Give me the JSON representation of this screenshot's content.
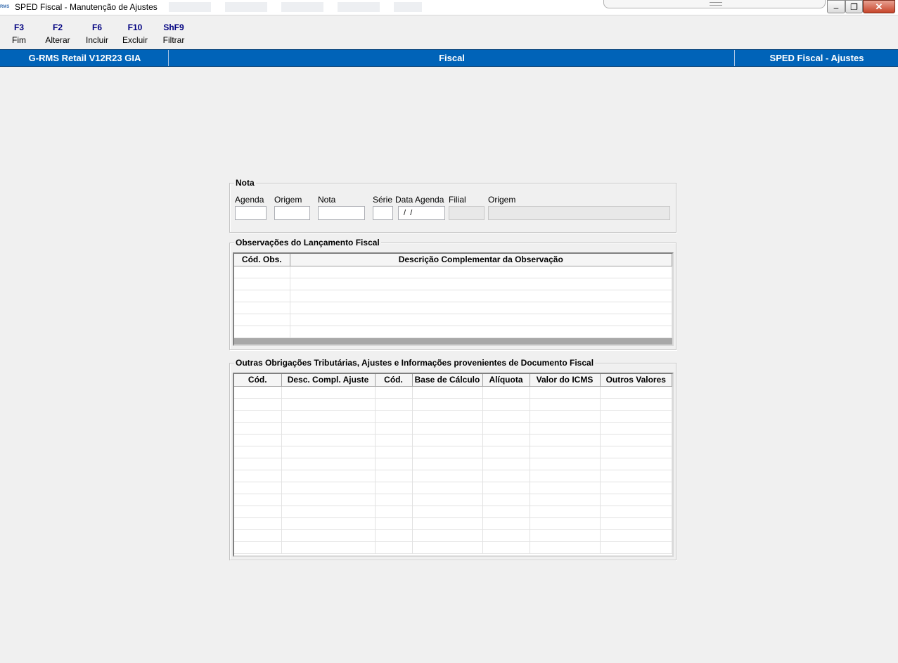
{
  "window": {
    "app_icon_text": "RMS",
    "title": "SPED Fiscal - Manutenção de Ajustes"
  },
  "toolbar": [
    {
      "key": "F3",
      "label": "Fim"
    },
    {
      "key": "F2",
      "label": "Alterar"
    },
    {
      "key": "F6",
      "label": "Incluir"
    },
    {
      "key": "F10",
      "label": "Excluir"
    },
    {
      "key": "ShF9",
      "label": "Filtrar"
    }
  ],
  "header": {
    "system": "G-RMS Retail V12R23 GIA",
    "module": "Fiscal",
    "screen": "SPED Fiscal - Ajustes"
  },
  "nota": {
    "legend": "Nota",
    "fields": {
      "agenda": {
        "label": "Agenda",
        "value": ""
      },
      "origem": {
        "label": "Origem",
        "value": ""
      },
      "nota": {
        "label": "Nota",
        "value": ""
      },
      "serie": {
        "label": "Série",
        "value": ""
      },
      "data_agenda": {
        "label": "Data Agenda",
        "value": " /  /"
      },
      "filial": {
        "label": "Filial",
        "value": ""
      },
      "origem_desc": {
        "label": "Origem",
        "value": ""
      }
    }
  },
  "observacoes": {
    "legend": "Observações do Lançamento Fiscal",
    "columns": [
      "Cód. Obs.",
      "Descrição Complementar da Observação"
    ],
    "rows": 6
  },
  "outras": {
    "legend": "Outras Obrigações Tributárias, Ajustes e Informações provenientes de Documento Fiscal",
    "columns": [
      "Cód.",
      "Desc. Compl. Ajuste",
      "Cód.",
      "Base de Cálculo",
      "Alíquota",
      "Valor do ICMS",
      "Outros Valores"
    ],
    "rows": 14
  },
  "colors": {
    "header_bg": "#0063b8",
    "window_bg": "#f0f0f0",
    "toolbar_key": "#000080"
  }
}
